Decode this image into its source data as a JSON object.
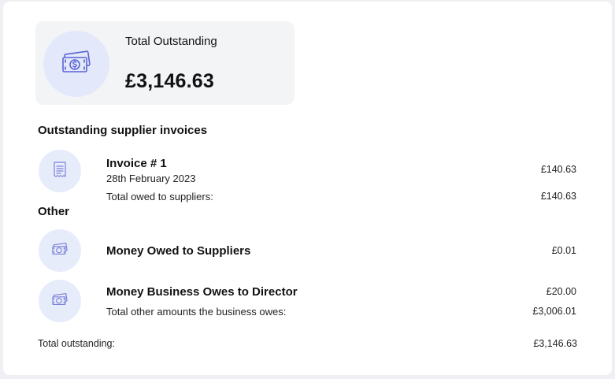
{
  "summary": {
    "label": "Total Outstanding",
    "amount": "£3,146.63",
    "icon": "money-icon"
  },
  "supplier_section": {
    "title": "Outstanding supplier invoices",
    "items": [
      {
        "title": "Invoice # 1",
        "date": "28th February 2023",
        "amount": "£140.63",
        "icon": "receipt-icon"
      }
    ],
    "total_label": "Total owed to suppliers:",
    "total_amount": "£140.63"
  },
  "other_section": {
    "title": "Other",
    "items": [
      {
        "title": "Money Owed to Suppliers",
        "amount": "£0.01",
        "icon": "money-icon"
      },
      {
        "title": "Money Business Owes to Director",
        "amount": "£20.00",
        "icon": "money-icon"
      }
    ],
    "total_label": "Total other amounts the business owes:",
    "total_amount": "£3,006.01"
  },
  "footer": {
    "label": "Total outstanding:",
    "amount": "£3,146.63"
  },
  "colors": {
    "accent": "#5b63d3",
    "icon_bg": "#e7ecfb",
    "summary_bg": "#f3f4f6"
  }
}
